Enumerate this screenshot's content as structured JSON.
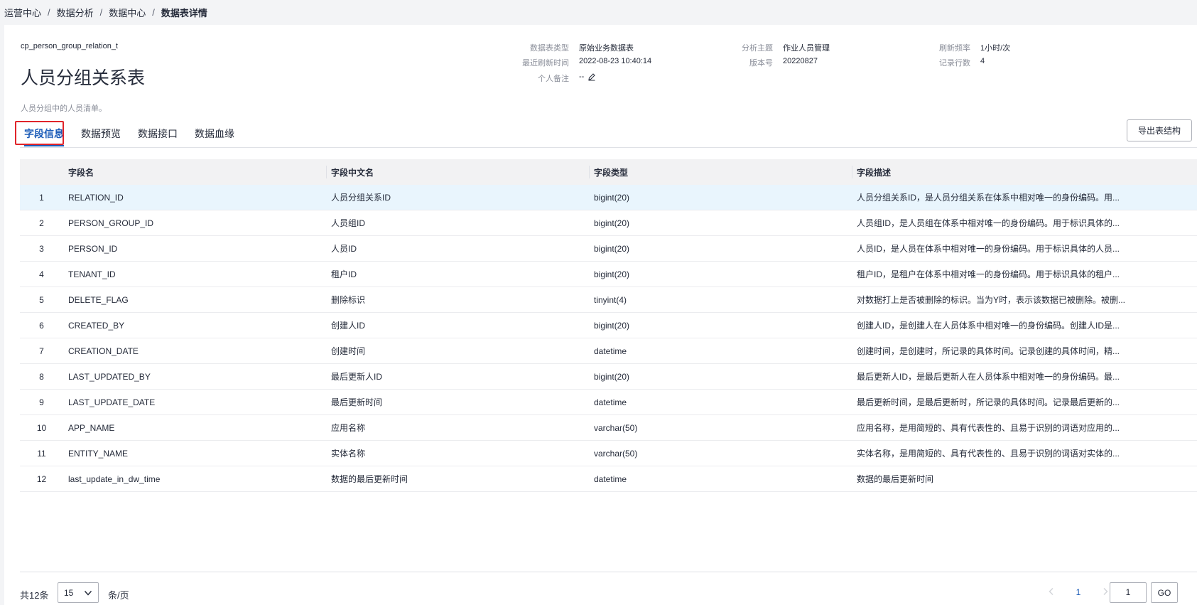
{
  "breadcrumb": {
    "items": [
      "运营中心",
      "数据分析",
      "数据中心"
    ],
    "current": "数据表详情",
    "separator": "/"
  },
  "header": {
    "code": "cp_person_group_relation_t",
    "title": "人员分组关系表",
    "description": "人员分组中的人员清单。"
  },
  "meta": {
    "table_type_label": "数据表类型",
    "table_type_value": "原始业务数据表",
    "refresh_time_label": "最近刷新时间",
    "refresh_time_value": "2022-08-23 10:40:14",
    "note_label": "个人备注",
    "note_value": "--",
    "topic_label": "分析主题",
    "topic_value": "作业人员管理",
    "version_label": "版本号",
    "version_value": "20220827",
    "frequency_label": "刷新频率",
    "frequency_value": "1小时/次",
    "rows_label": "记录行数",
    "rows_value": "4"
  },
  "tabs": [
    {
      "label": "字段信息",
      "active": true
    },
    {
      "label": "数据预览",
      "active": false
    },
    {
      "label": "数据接口",
      "active": false
    },
    {
      "label": "数据血缘",
      "active": false
    }
  ],
  "export_button": "导出表结构",
  "table": {
    "columns": [
      "",
      "字段名",
      "字段中文名",
      "字段类型",
      "字段描述"
    ],
    "rows": [
      [
        "1",
        "RELATION_ID",
        "人员分组关系ID",
        "bigint(20)",
        "人员分组关系ID，是人员分组关系在体系中相对唯一的身份编码。用..."
      ],
      [
        "2",
        "PERSON_GROUP_ID",
        "人员组ID",
        "bigint(20)",
        "人员组ID，是人员组在体系中相对唯一的身份编码。用于标识具体的..."
      ],
      [
        "3",
        "PERSON_ID",
        "人员ID",
        "bigint(20)",
        "人员ID，是人员在体系中相对唯一的身份编码。用于标识具体的人员..."
      ],
      [
        "4",
        "TENANT_ID",
        "租户ID",
        "bigint(20)",
        "租户ID，是租户在体系中相对唯一的身份编码。用于标识具体的租户..."
      ],
      [
        "5",
        "DELETE_FLAG",
        "删除标识",
        "tinyint(4)",
        "对数据打上是否被删除的标识。当为Y时，表示该数据已被删除。被删..."
      ],
      [
        "6",
        "CREATED_BY",
        "创建人ID",
        "bigint(20)",
        "创建人ID，是创建人在人员体系中相对唯一的身份编码。创建人ID是..."
      ],
      [
        "7",
        "CREATION_DATE",
        "创建时间",
        "datetime",
        "创建时间，是创建时，所记录的具体时间。记录创建的具体时间，精..."
      ],
      [
        "8",
        "LAST_UPDATED_BY",
        "最后更新人ID",
        "bigint(20)",
        "最后更新人ID，是最后更新人在人员体系中相对唯一的身份编码。最..."
      ],
      [
        "9",
        "LAST_UPDATE_DATE",
        "最后更新时间",
        "datetime",
        "最后更新时间，是最后更新时，所记录的具体时间。记录最后更新的..."
      ],
      [
        "10",
        "APP_NAME",
        "应用名称",
        "varchar(50)",
        "应用名称，是用简短的、具有代表性的、且易于识别的词语对应用的..."
      ],
      [
        "11",
        "ENTITY_NAME",
        "实体名称",
        "varchar(50)",
        "实体名称，是用简短的、具有代表性的、且易于识别的词语对实体的..."
      ],
      [
        "12",
        "last_update_in_dw_time",
        "数据的最后更新时间",
        "datetime",
        "数据的最后更新时间"
      ]
    ],
    "selected_row": 0
  },
  "footer": {
    "total": "共12条",
    "page_size": "15",
    "per_page": "条/页",
    "current_page": "1",
    "goto_value": "1",
    "go_label": "GO"
  },
  "colors": {
    "accent": "#1c5cb8",
    "highlight_border": "#e0242a",
    "selected_row": "#e9f5fd"
  },
  "icons": [
    "edit-icon",
    "chevron-down-icon",
    "chevron-left-icon",
    "chevron-right-icon"
  ]
}
